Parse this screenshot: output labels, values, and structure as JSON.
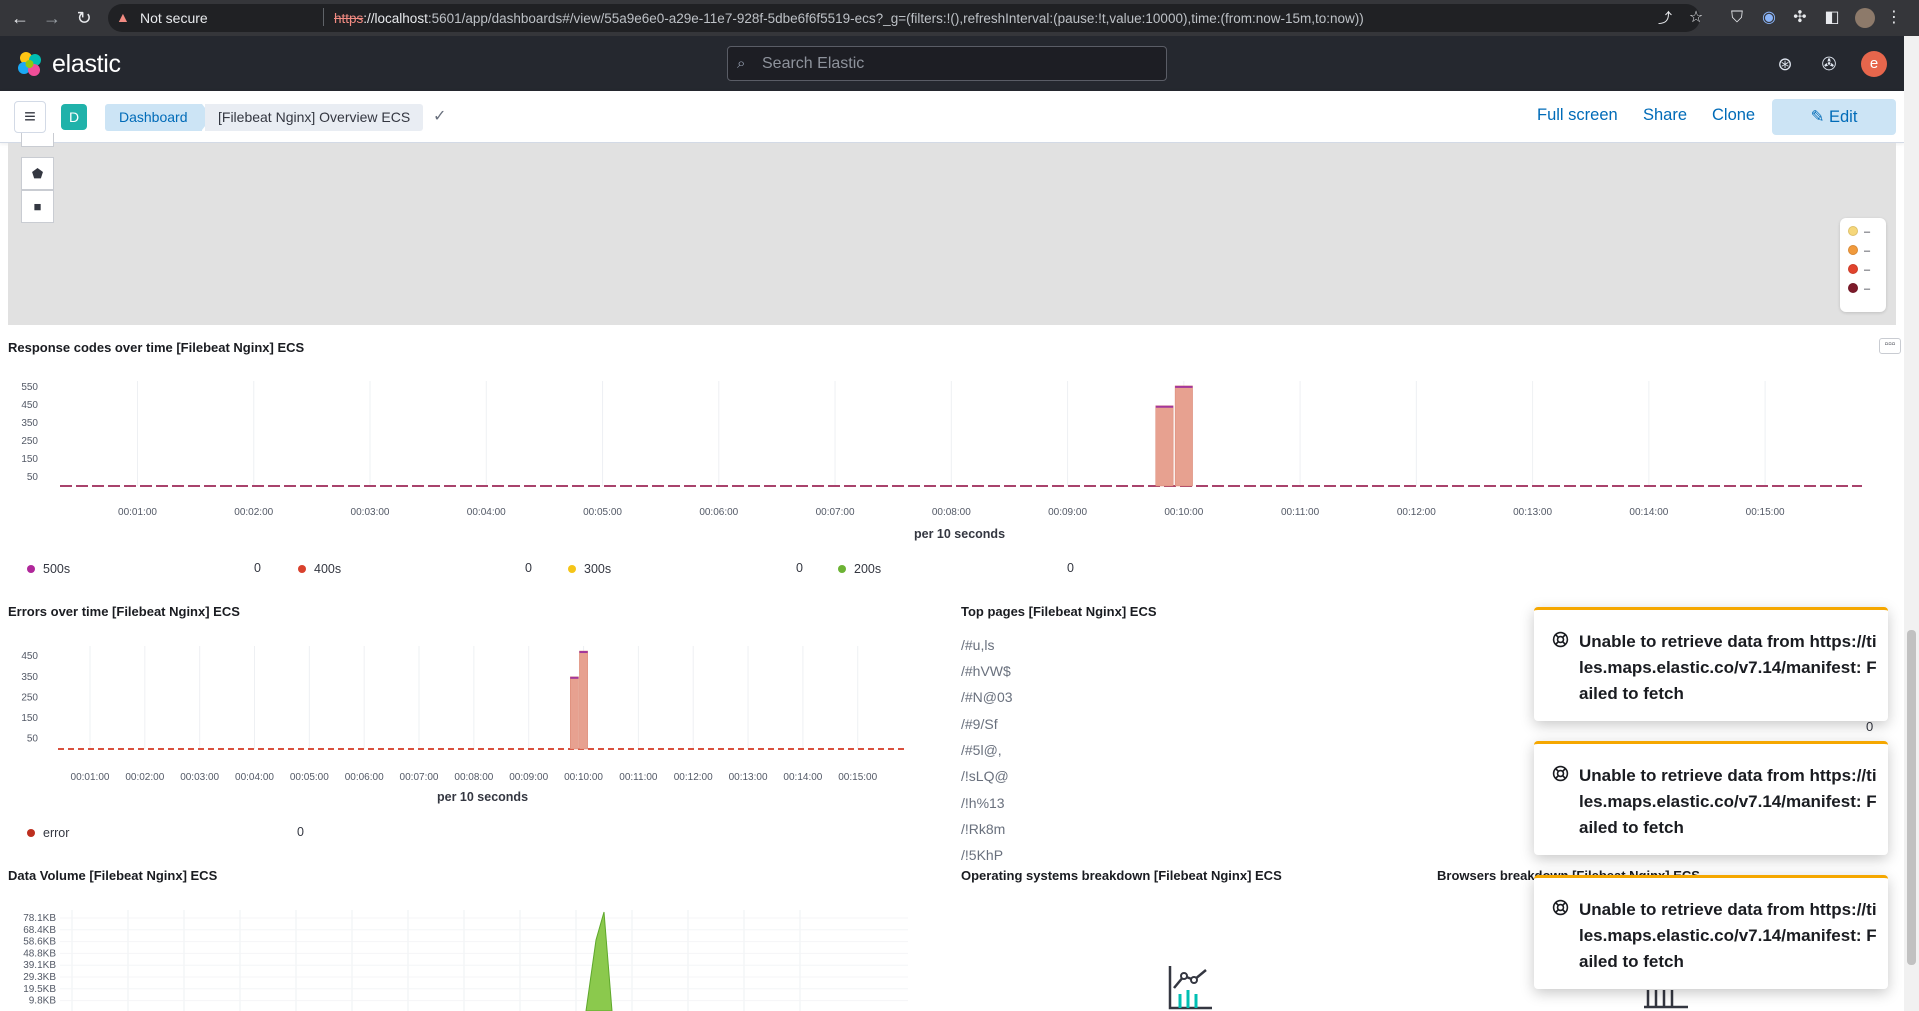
{
  "browser": {
    "not_secure": "Not secure",
    "url_scheme": "https",
    "url_host": "://localhost",
    "url_rest": ":5601/app/dashboards#/view/55a9e6e0-a29e-11e7-928f-5dbe6f6f5519-ecs?_g=(filters:!(),refreshInterval:(pause:!t,value:10000),time:(from:now-15m,to:now))"
  },
  "header": {
    "logo_text": "elastic",
    "search_placeholder": "Search Elastic",
    "avatar_letter": "e"
  },
  "breadcrumbs": {
    "space_letter": "D",
    "items": [
      "Dashboard",
      "[Filebeat Nginx] Overview ECS"
    ]
  },
  "actions": {
    "full_screen": "Full screen",
    "share": "Share",
    "clone": "Clone",
    "edit": "Edit"
  },
  "map_legend": {
    "entries": [
      {
        "label": "–",
        "color": "#f6d77a"
      },
      {
        "label": "–",
        "color": "#f19a3c"
      },
      {
        "label": "–",
        "color": "#e1432d"
      },
      {
        "label": "–",
        "color": "#7d1a2a"
      }
    ]
  },
  "panels": {
    "response_codes": {
      "title": "Response codes over time [Filebeat Nginx] ECS",
      "xlabel": "per 10 seconds",
      "legend": [
        {
          "label": "500s",
          "value": "0",
          "color": "#b0279a"
        },
        {
          "label": "400s",
          "value": "0",
          "color": "#d9412d"
        },
        {
          "label": "300s",
          "value": "0",
          "color": "#f5c518"
        },
        {
          "label": "200s",
          "value": "0",
          "color": "#6cb334"
        }
      ]
    },
    "errors": {
      "title": "Errors over time [Filebeat Nginx] ECS",
      "xlabel": "per 10 seconds",
      "legend": [
        {
          "label": "error",
          "value": "0",
          "color": "#bd2f1f"
        }
      ]
    },
    "top_pages": {
      "title": "Top pages [Filebeat Nginx] ECS",
      "items": [
        "/#u,ls",
        "/#hVW$",
        "/#N@03",
        "/#9/Sf",
        "/#5l@,",
        "/!sLQ@",
        "/!h%13",
        "/!Rk8m",
        "/!5KhP"
      ],
      "visible_count": "0"
    },
    "data_volume": {
      "title": "Data Volume [Filebeat Nginx] ECS"
    },
    "os_breakdown": {
      "title": "Operating systems breakdown [Filebeat Nginx] ECS"
    },
    "browsers_breakdown": {
      "title": "Browsers breakdown [Filebeat Nginx] ECS"
    }
  },
  "toasts": [
    {
      "text": "Unable to retrieve data from https://tiles.maps.elastic.co/v7.14/manifest: Failed to fetch"
    },
    {
      "text": "Unable to retrieve data from https://tiles.maps.elastic.co/v7.14/manifest: Failed to fetch"
    },
    {
      "text": "Unable to retrieve data from https://tiles.maps.elastic.co/v7.14/manifest: Failed to fetch"
    }
  ],
  "chart_data": [
    {
      "type": "bar",
      "title": "Response codes over time [Filebeat Nginx] ECS",
      "xlabel": "per 10 seconds",
      "yticks": [
        50,
        150,
        250,
        350,
        450,
        550
      ],
      "xticks": [
        "00:01:00",
        "00:02:00",
        "00:03:00",
        "00:04:00",
        "00:05:00",
        "00:06:00",
        "00:07:00",
        "00:08:00",
        "00:09:00",
        "00:10:00",
        "00:11:00",
        "00:12:00",
        "00:13:00",
        "00:14:00",
        "00:15:00"
      ],
      "ylim": [
        0,
        560
      ],
      "bars": [
        {
          "x": "00:09:50",
          "value": 445
        },
        {
          "x": "00:10:00",
          "value": 555
        }
      ]
    },
    {
      "type": "bar",
      "title": "Errors over time [Filebeat Nginx] ECS",
      "xlabel": "per 10 seconds",
      "yticks": [
        50,
        150,
        250,
        350,
        450
      ],
      "xticks": [
        "00:01:00",
        "00:02:00",
        "00:03:00",
        "00:04:00",
        "00:05:00",
        "00:06:00",
        "00:07:00",
        "00:08:00",
        "00:09:00",
        "00:10:00",
        "00:11:00",
        "00:12:00",
        "00:13:00",
        "00:14:00",
        "00:15:00"
      ],
      "ylim": [
        0,
        480
      ],
      "bars": [
        {
          "x": "00:09:50",
          "value": 350
        },
        {
          "x": "00:10:00",
          "value": 475
        }
      ]
    },
    {
      "type": "area",
      "title": "Data Volume [Filebeat Nginx] ECS",
      "yticks": [
        "78.1KB",
        "68.4KB",
        "58.6KB",
        "48.8KB",
        "39.1KB",
        "29.3KB",
        "19.5KB",
        "9.8KB"
      ],
      "peak_value": "78.1KB"
    }
  ]
}
